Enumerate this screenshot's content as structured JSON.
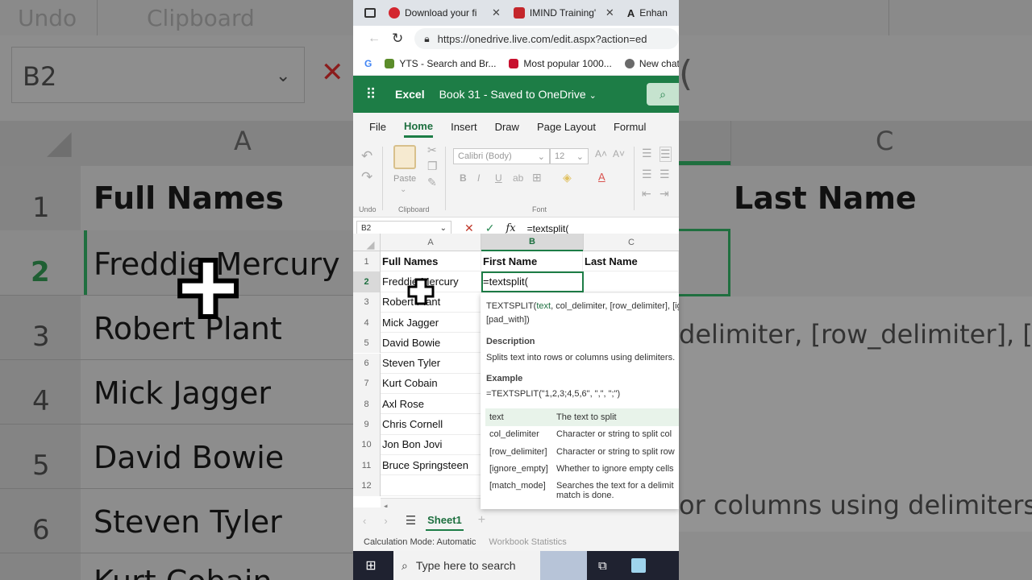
{
  "browser": {
    "tabs": [
      {
        "label": "Download your fi",
        "color": "#d3262f"
      },
      {
        "label": "IMIND Training's",
        "color": "#c4262b"
      },
      {
        "label": "Enhan",
        "color": "#222"
      }
    ],
    "url": "https://onedrive.live.com/edit.aspx?action=ed",
    "bookmarks": [
      {
        "label": "",
        "color": "#4285f4"
      },
      {
        "label": "YTS - Search and Br...",
        "color": "#5b8c2a"
      },
      {
        "label": "Most popular 1000...",
        "color": "#c8102e"
      },
      {
        "label": "New chat",
        "color": "#6a6a6a"
      }
    ]
  },
  "excel": {
    "app_name": "Excel",
    "doc_title": "Book 31  -  Saved to OneDrive",
    "menu": [
      "File",
      "Home",
      "Insert",
      "Draw",
      "Page Layout",
      "Formul"
    ],
    "active_menu": "Home",
    "ribbon": {
      "undo_label": "Undo",
      "clipboard_label": "Clipboard",
      "paste_label": "Paste",
      "font_label": "Font",
      "font_name": "Calibri (Body)",
      "font_size": "12"
    },
    "name_box": "B2",
    "formula": "=textsplit(",
    "columns": [
      "A",
      "B",
      "C"
    ],
    "rows": [
      {
        "num": "1",
        "a": "Full Names",
        "b": "First Name",
        "c": "Last Name"
      },
      {
        "num": "2",
        "a": "Freddie Mercury",
        "b": "=textsplit(",
        "c": ""
      },
      {
        "num": "3",
        "a": "Robert Plant",
        "b": "",
        "c": ""
      },
      {
        "num": "4",
        "a": "Mick Jagger",
        "b": "",
        "c": ""
      },
      {
        "num": "5",
        "a": "David Bowie",
        "b": "",
        "c": ""
      },
      {
        "num": "6",
        "a": "Steven Tyler",
        "b": "",
        "c": ""
      },
      {
        "num": "7",
        "a": "Kurt Cobain",
        "b": "",
        "c": ""
      },
      {
        "num": "8",
        "a": "Axl Rose",
        "b": "",
        "c": ""
      },
      {
        "num": "9",
        "a": "Chris Cornell",
        "b": "",
        "c": ""
      },
      {
        "num": "10",
        "a": "Jon Bon Jovi",
        "b": "",
        "c": ""
      },
      {
        "num": "11",
        "a": "Bruce Springsteen",
        "b": "",
        "c": ""
      },
      {
        "num": "12",
        "a": "",
        "b": "",
        "c": ""
      }
    ],
    "tooltip": {
      "fn": "TEXTSPLIT(",
      "first_arg": "text",
      "rest_sig": ", col_delimiter, [row_delimiter], [ig",
      "sig_line2": "[pad_with])",
      "desc_title": "Description",
      "desc": "Splits text into rows or columns using delimiters.",
      "ex_title": "Example",
      "ex": "=TEXTSPLIT(\"1,2,3;4,5,6\", \",\", \";\")",
      "args": [
        {
          "name": "text",
          "desc": "The text to split"
        },
        {
          "name": "col_delimiter",
          "desc": "Character or string to split col"
        },
        {
          "name": "[row_delimiter]",
          "desc": "Character or string to split row"
        },
        {
          "name": "[ignore_empty]",
          "desc": "Whether to ignore empty cells"
        },
        {
          "name": "[match_mode]",
          "desc": "Searches the text for a delimit",
          "desc2": "match is done."
        }
      ]
    },
    "sheet_tab": "Sheet1",
    "status": {
      "calc": "Calculation Mode: Automatic",
      "stats": "Workbook Statistics"
    }
  },
  "taskbar": {
    "search_placeholder": "Type here to search"
  },
  "background": {
    "top_labels": [
      "Undo",
      "Clipboard"
    ],
    "name_box": "B2",
    "col_a": "A",
    "col_c": "C",
    "left_rows": [
      {
        "num": "1",
        "text": "Full Names"
      },
      {
        "num": "2",
        "text": "Freddie Mercury"
      },
      {
        "num": "3",
        "text": "Robert Plant"
      },
      {
        "num": "4",
        "text": "Mick Jagger"
      },
      {
        "num": "5",
        "text": "David Bowie"
      },
      {
        "num": "6",
        "text": "Steven Tyler"
      },
      {
        "num": "",
        "text": "Kurt Cobain"
      }
    ],
    "right_header": "Last Name",
    "right_sig": "delimiter, [row_delimiter], [ig",
    "right_desc": "or columns using delimiters."
  }
}
